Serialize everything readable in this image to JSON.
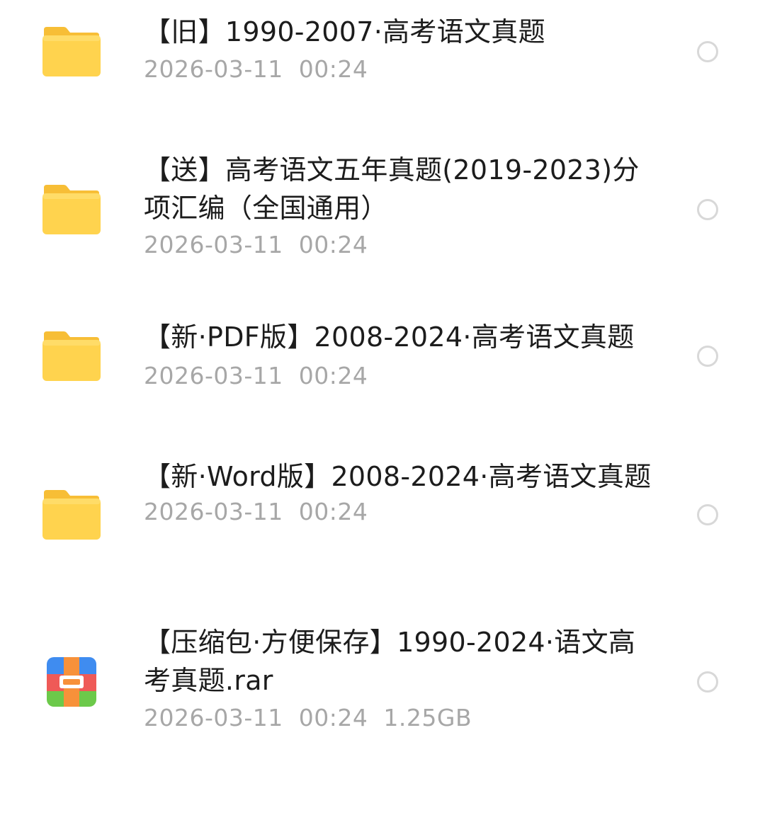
{
  "files": [
    {
      "name": "【旧】1990-2007·高考语文真题",
      "date": "2026-03-11",
      "time": "00:24",
      "size": "",
      "icon": "folder-icon"
    },
    {
      "name": "【送】高考语文五年真题(2019-2023)分项汇编（全国通用）",
      "date": "2026-03-11",
      "time": "00:24",
      "size": "",
      "icon": "folder-icon"
    },
    {
      "name": "【新·PDF版】2008-2024·高考语文真题",
      "date": "2026-03-11",
      "time": "00:24",
      "size": "",
      "icon": "folder-icon"
    },
    {
      "name": "【新·Word版】2008-2024·高考语文真题",
      "date": "2026-03-11",
      "time": "00:24",
      "size": "",
      "icon": "folder-icon"
    },
    {
      "name": "【压缩包·方便保存】1990-2024·语文高考真题.rar",
      "date": "2026-03-11",
      "time": "00:24",
      "size": "1.25GB",
      "icon": "archive-icon"
    }
  ],
  "colors": {
    "folder_body": "#FFD34E",
    "folder_tab": "#F9C23C",
    "name_text": "#1c1c1c",
    "meta_text": "#a7a7a7",
    "select_border": "#d8d8d8"
  }
}
